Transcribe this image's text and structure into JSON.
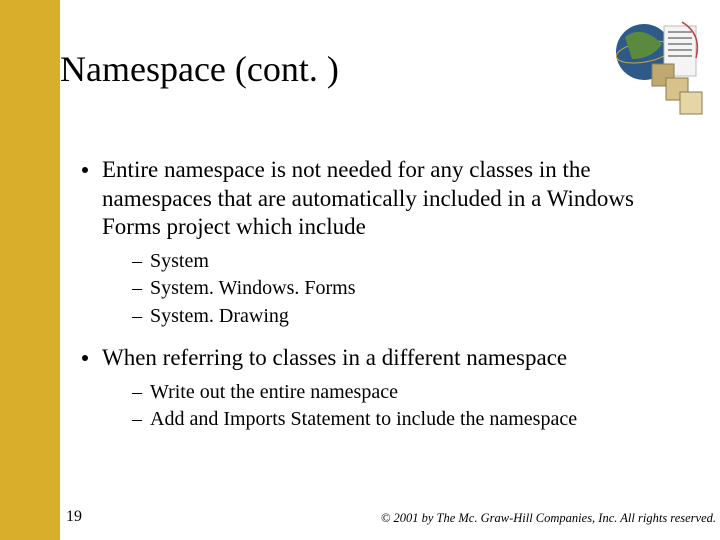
{
  "title": "Namespace (cont. )",
  "bullets": [
    {
      "text": "Entire namespace is not needed for any classes in the namespaces that are automatically included in a Windows Forms project which include",
      "sub": [
        "System",
        "System. Windows. Forms",
        "System. Drawing"
      ]
    },
    {
      "text": "When referring to classes in a different namespace",
      "sub": [
        "Write out the entire namespace",
        "Add and Imports Statement to include the namespace"
      ]
    }
  ],
  "page_number": "19",
  "copyright": "© 2001 by The Mc. Graw-Hill Companies, Inc. All rights reserved."
}
